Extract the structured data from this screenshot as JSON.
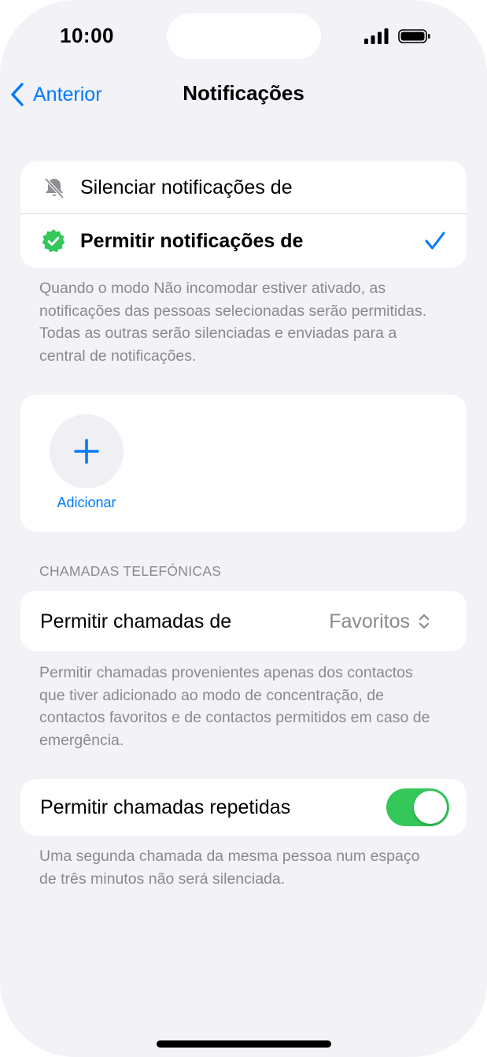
{
  "status_bar": {
    "time": "10:00"
  },
  "nav": {
    "back_label": "Anterior",
    "title": "Notificações"
  },
  "notifications_mode": {
    "items": [
      {
        "label": "Silenciar notificações de",
        "icon": "bell-slash-icon",
        "selected": false
      },
      {
        "label": "Permitir notificações de",
        "icon": "verified-badge-icon",
        "selected": true
      }
    ],
    "footnote": "Quando o modo Não incomodar estiver ativado, as notificações das pessoas selecionadas serão permitidas. Todas as outras serão silenciadas e enviadas para a central de notificações."
  },
  "people": {
    "add_label": "Adicionar"
  },
  "calls": {
    "section_header": "CHAMADAS TELEFÓNICAS",
    "allow_calls_label": "Permitir chamadas de",
    "allow_calls_value": "Favoritos",
    "allow_calls_footnote": "Permitir chamadas provenientes apenas dos contactos que tiver adicionado ao modo de concentração, de contactos favoritos e de contactos permitidos em caso de emergência.",
    "repeated_label": "Permitir chamadas repetidas",
    "repeated_enabled": true,
    "repeated_footnote": "Uma segunda chamada da mesma pessoa num espaço de três minutos não será silenciada."
  },
  "colors": {
    "accent": "#007aff",
    "toggle_on": "#34c759",
    "badge": "#34c759",
    "background": "#f2f2f7"
  }
}
